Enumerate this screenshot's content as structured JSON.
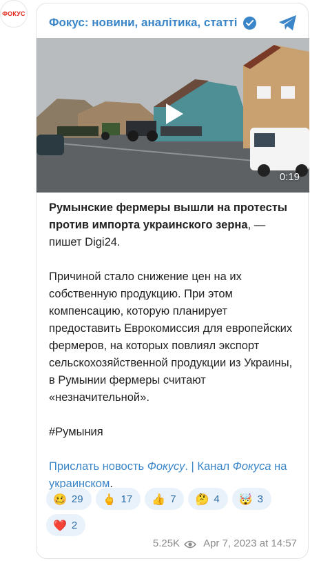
{
  "avatar": {
    "label": "ФОКУС"
  },
  "header": {
    "title": "Фокус: новини, аналітика, статті"
  },
  "video": {
    "duration": "0:19"
  },
  "post": {
    "lead_bold": "Румынские фермеры вышли на протесты против импорта украинского зерна",
    "lead_rest": ", — пишет Digi24.",
    "body": "Причиной стало снижение цен на их собственную продукцию. При этом компенсацию, которую планирует предоставить Еврокомиссия для европейских фермеров, на которых повлиял экспорт сельскохозяйственной продукции из Украины, в Румынии фермеры считают «незначительной».",
    "hashtag": "#Румыния",
    "link1_text": "Прислать новость ",
    "link1_italic": "Фокусу",
    "separator": ". | ",
    "link2_text": "Канал",
    "link2_italic": "Фокуса",
    "link2_rest": " на украинском",
    "end": "."
  },
  "reactions": [
    {
      "emoji": "🥴",
      "count": "29"
    },
    {
      "emoji": "🖕",
      "count": "17"
    },
    {
      "emoji": "👍",
      "count": "7"
    },
    {
      "emoji": "🤔",
      "count": "4"
    },
    {
      "emoji": "🤯",
      "count": "3"
    },
    {
      "emoji": "❤️",
      "count": "2"
    }
  ],
  "footer": {
    "views": "5.25K",
    "timestamp": "Apr 7, 2023 at 14:57"
  },
  "colors": {
    "accent": "#3a86c8",
    "reaction_bg": "#e9f2fb",
    "brand_red": "#e1261c"
  }
}
